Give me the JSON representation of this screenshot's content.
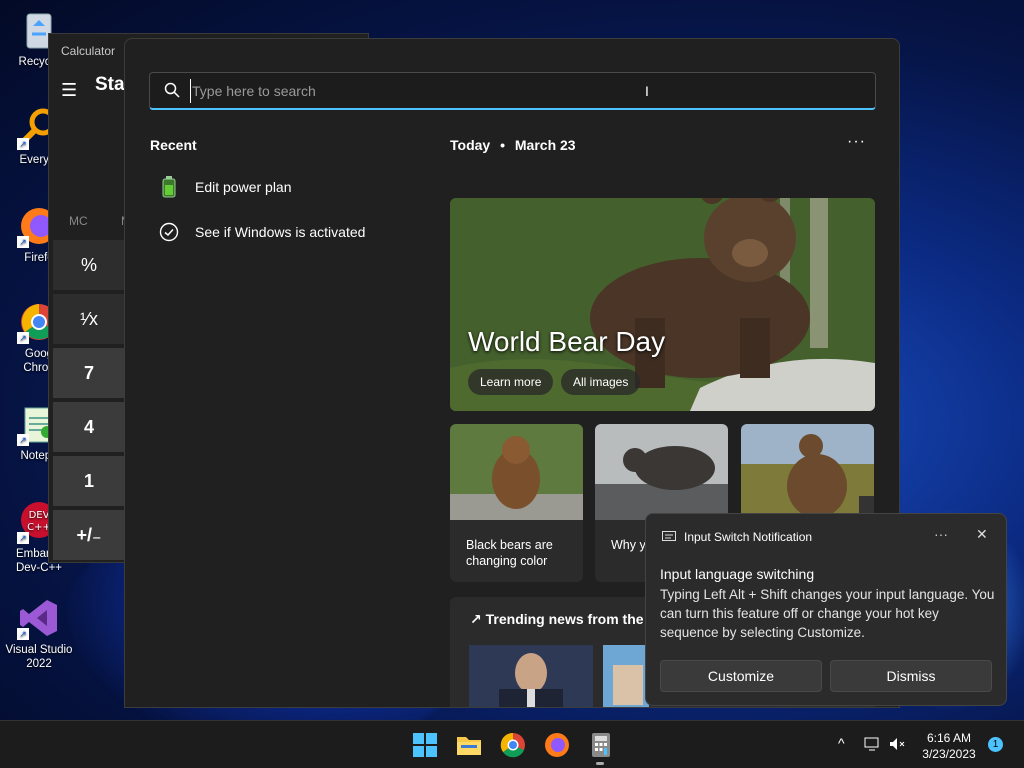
{
  "desktop": {
    "icons": [
      {
        "label": "Recycle",
        "icon": "recycle-bin-icon"
      },
      {
        "label": "Everyth",
        "icon": "everything-search-icon"
      },
      {
        "label": "Firefo",
        "icon": "firefox-icon"
      },
      {
        "label": "Goog Chron",
        "icon": "chrome-icon"
      },
      {
        "label": "Notepa",
        "icon": "notepad-icon"
      },
      {
        "label": "Embarca Dev-C++",
        "icon": "devcpp-icon"
      },
      {
        "label": "Visual Studio 2022",
        "icon": "visual-studio-icon"
      }
    ]
  },
  "calculator": {
    "title": "Calculator",
    "mode": "Star",
    "memory_label": "MC",
    "memory_label2": "M",
    "keys": [
      "%",
      "¹⁄x",
      "7",
      "4",
      "1",
      "+/₋"
    ]
  },
  "search": {
    "placeholder": "Type here to search",
    "value": ""
  },
  "recent": {
    "title": "Recent",
    "items": [
      {
        "label": "Edit power plan",
        "icon": "battery-icon"
      },
      {
        "label": "See if Windows is activated",
        "icon": "check-circle-icon"
      }
    ]
  },
  "today": {
    "heading": "Today",
    "date": "March 23",
    "separator": "•",
    "more": "···",
    "hero": {
      "title": "World Bear Day",
      "learn_more": "Learn more",
      "all_images": "All images"
    },
    "cards": [
      {
        "text": "Black bears are changing color"
      },
      {
        "text": "Why y should"
      },
      {
        "text": ""
      }
    ],
    "trending_title": "Trending news from the v"
  },
  "notification": {
    "app_name": "Input Switch Notification",
    "more": "···",
    "close": "✕",
    "heading": "Input language switching",
    "body": "Typing Left Alt + Shift changes your input language. You can turn this feature off or change your hot key sequence by selecting Customize.",
    "customize": "Customize",
    "dismiss": "Dismiss"
  },
  "taskbar": {
    "apps": [
      "start-icon",
      "file-explorer-icon",
      "chrome-icon",
      "firefox-icon",
      "calculator-icon"
    ],
    "time": "6:16 AM",
    "date": "3/23/2023",
    "notification_count": "1",
    "tray_chevron": "^"
  },
  "colors": {
    "accent": "#4cc2ff",
    "panel_bg": "#202020",
    "card_bg": "#2b2b2b"
  }
}
